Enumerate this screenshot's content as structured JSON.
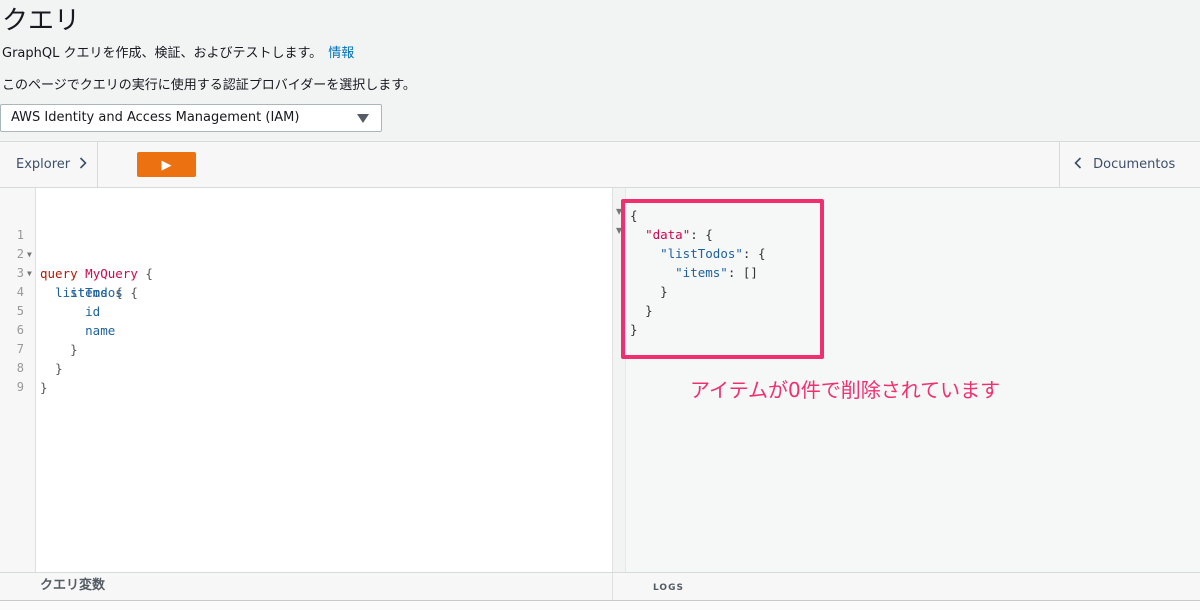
{
  "page": {
    "title": "クエリ",
    "subtitle": "GraphQL クエリを作成、検証、およびテストします。",
    "info_link": "情報",
    "description": "このページでクエリの実行に使用する認証プロバイダーを選択します。"
  },
  "auth_select": {
    "selected": "AWS Identity and Access Management (IAM)"
  },
  "toolbar": {
    "explorer_label": "Explorer",
    "explorer_icon": "chevron-right-icon",
    "run_icon": "play-icon",
    "run_glyph": "▶",
    "docs_label": "Documentos",
    "docs_icon": "chevron-left-icon",
    "run_color": "#ec7211"
  },
  "editor": {
    "line_numbers": [
      "1",
      "2",
      "3",
      "4",
      "5",
      "6",
      "7",
      "8",
      "9"
    ],
    "lines": [
      {
        "kw": "query",
        "def": "MyQuery",
        "pun": "{"
      },
      {
        "prop": "listTodos",
        "pun": "{"
      },
      {
        "prop": "items",
        "pun": "{"
      },
      {
        "prop": "id"
      },
      {
        "prop": "name"
      },
      {
        "pun": "}"
      },
      {
        "pun": "}"
      },
      {
        "pun": "}"
      },
      {}
    ]
  },
  "result": {
    "open_brace": "{",
    "data_key": "\"data\"",
    "list_key": "\"listTodos\"",
    "items_key": "\"items\"",
    "items_value": "[]",
    "colon_brace": ": {",
    "colon": ": ",
    "close_brace": "}"
  },
  "annotation": {
    "text": "アイテムが0件で削除されています",
    "color": "#f0306e"
  },
  "footer": {
    "variables_label": "クエリ変数",
    "logs_label": "LOGS"
  }
}
